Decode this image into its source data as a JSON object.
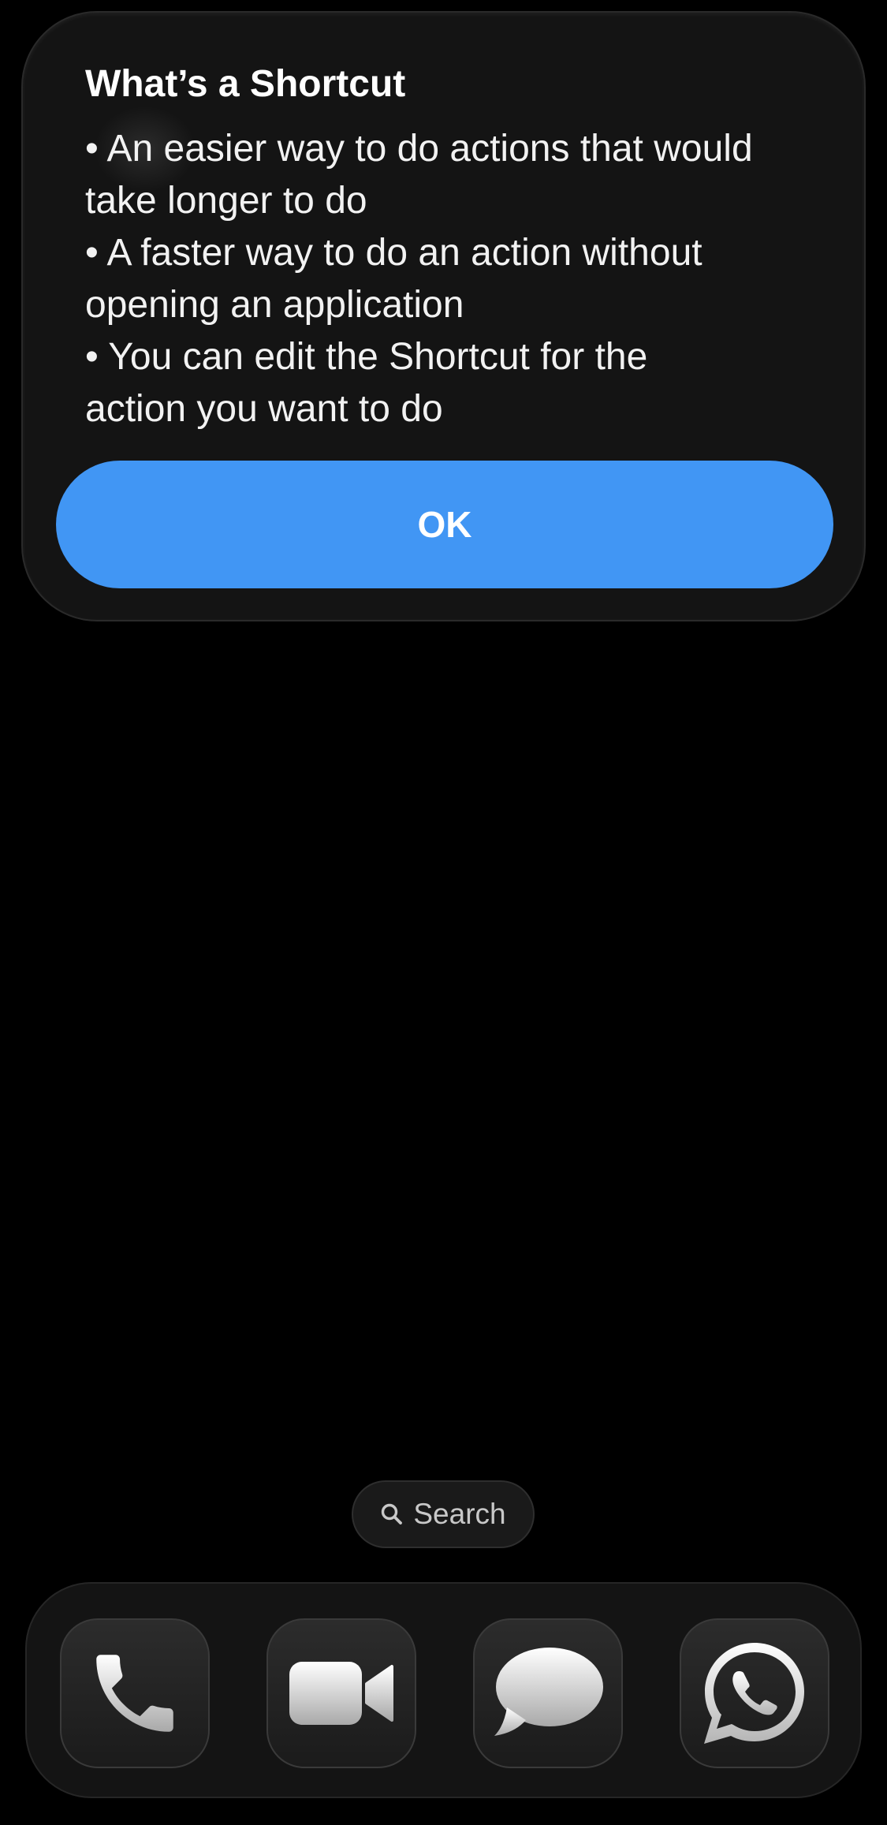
{
  "alert": {
    "title": "What’s a Shortcut",
    "body_lines": [
      "• An easier way to do actions that would",
      "take longer to do",
      "• A faster way to do an action without",
      "opening an application",
      "• You can edit the Shortcut for the",
      "action you want to do"
    ],
    "ok_label": "OK",
    "button_color": "#4196f4"
  },
  "search": {
    "label": "Search",
    "icon": "search-icon"
  },
  "dock": {
    "apps": [
      {
        "name": "Phone",
        "icon": "phone-icon"
      },
      {
        "name": "FaceTime",
        "icon": "video-camera-icon"
      },
      {
        "name": "Messages",
        "icon": "speech-bubble-icon"
      },
      {
        "name": "WhatsApp",
        "icon": "whatsapp-icon"
      }
    ]
  }
}
